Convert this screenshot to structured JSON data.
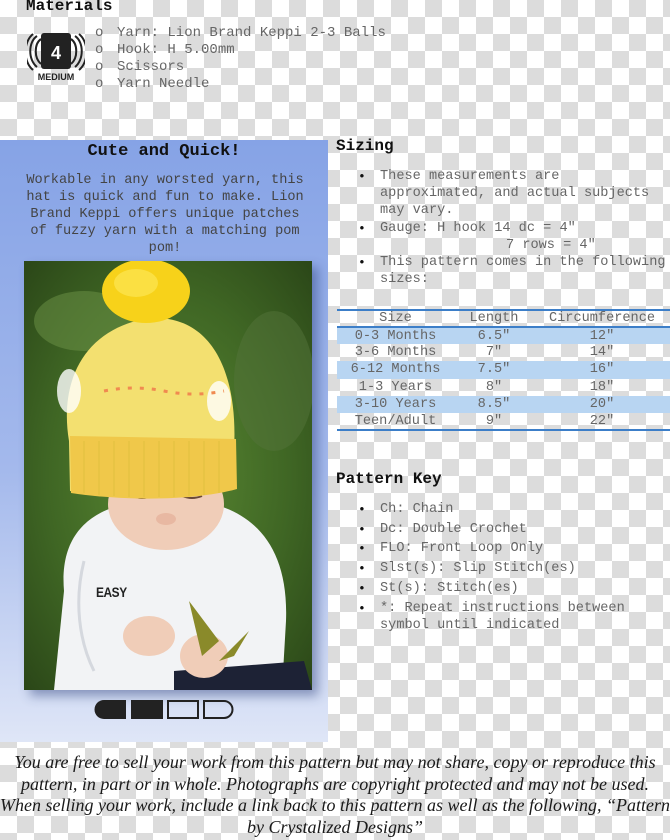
{
  "materials": {
    "title": "Materials",
    "yarn_weight_icon": {
      "number": "4",
      "label": "MEDIUM"
    },
    "bullet": "o",
    "items": [
      "Yarn: Lion Brand Keppi 2-3 Balls",
      "Hook: H 5.00mm",
      "Scissors",
      "Yarn Needle"
    ]
  },
  "promo": {
    "title": "Cute and Quick!",
    "text": "Workable in any worsted yarn, this hat is quick and fun to make. Lion Brand Keppi offers unique patches of fuzzy yarn with a matching pom pom!",
    "photo_alt": "Baby wearing a yellow crocheted hat with pom pom",
    "difficulty": {
      "label": "EASY",
      "level": 2,
      "max": 4
    }
  },
  "sizing": {
    "title": "Sizing",
    "bullet": "•",
    "items": [
      "These measurements are approximated, and actual subjects may vary.",
      "Gauge: H hook 14 dc = 4\"",
      "This pattern comes in the following sizes:"
    ],
    "gauge_second_line": "7 rows = 4\"",
    "table": {
      "headers": [
        "Size",
        "Length",
        "Circumference"
      ],
      "rows": [
        [
          "0-3 Months",
          "6.5\"",
          "12\""
        ],
        [
          "3-6 Months",
          "7\"",
          "14\""
        ],
        [
          "6-12 Months",
          "7.5\"",
          "16\""
        ],
        [
          "1-3 Years",
          "8\"",
          "18\""
        ],
        [
          "3-10 Years",
          "8.5\"",
          "20\""
        ],
        [
          "Teen/Adult",
          "9\"",
          "22\""
        ]
      ],
      "accent_color": "#3c7ec8",
      "shade_color": "#b8d5f2"
    }
  },
  "pattern_key": {
    "title": "Pattern Key",
    "bullet": "•",
    "items": [
      "Ch: Chain",
      "Dc: Double Crochet",
      "FLO: Front Loop Only",
      "Slst(s): Slip Stitch(es)",
      "St(s): Stitch(es)",
      "*: Repeat instructions between symbol until indicated"
    ]
  },
  "footer": {
    "text": "You are free to sell your work from this pattern but may not share, copy or reproduce this pattern, in part or in whole. Photographs are copyright protected and may not be used. When selling your work, include a link back to this pattern as well as the following, “Pattern by Crystalized Designs”"
  }
}
